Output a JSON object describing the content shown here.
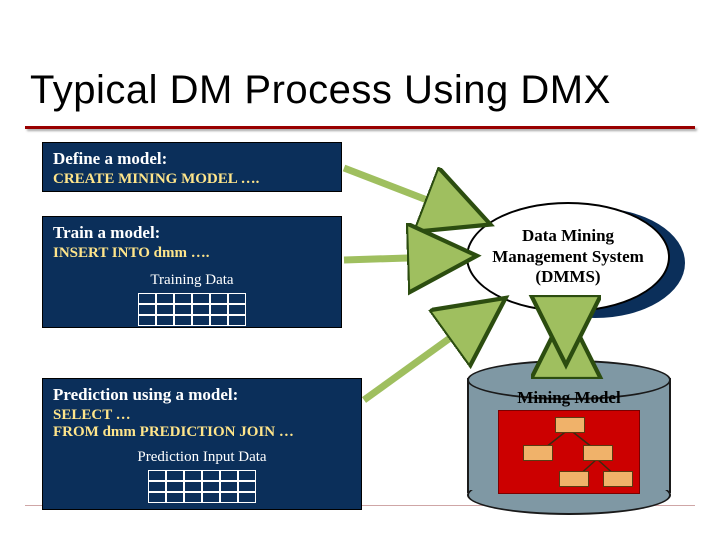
{
  "title": "Typical DM Process Using DMX",
  "boxes": {
    "define": {
      "heading": "Define a model:",
      "code": "CREATE MINING MODEL …."
    },
    "train": {
      "heading": "Train a model:",
      "code": "INSERT INTO dmm ….",
      "sub": "Training Data"
    },
    "predict": {
      "heading": "Prediction using a model:",
      "code1": "SELECT …",
      "code2": "FROM dmm PREDICTION JOIN …",
      "sub": "Prediction Input Data"
    }
  },
  "dmms": {
    "line1": "Data Mining",
    "line2": "Management System",
    "line3": "(DMMS)"
  },
  "cylinder": {
    "label": "Mining Model"
  }
}
